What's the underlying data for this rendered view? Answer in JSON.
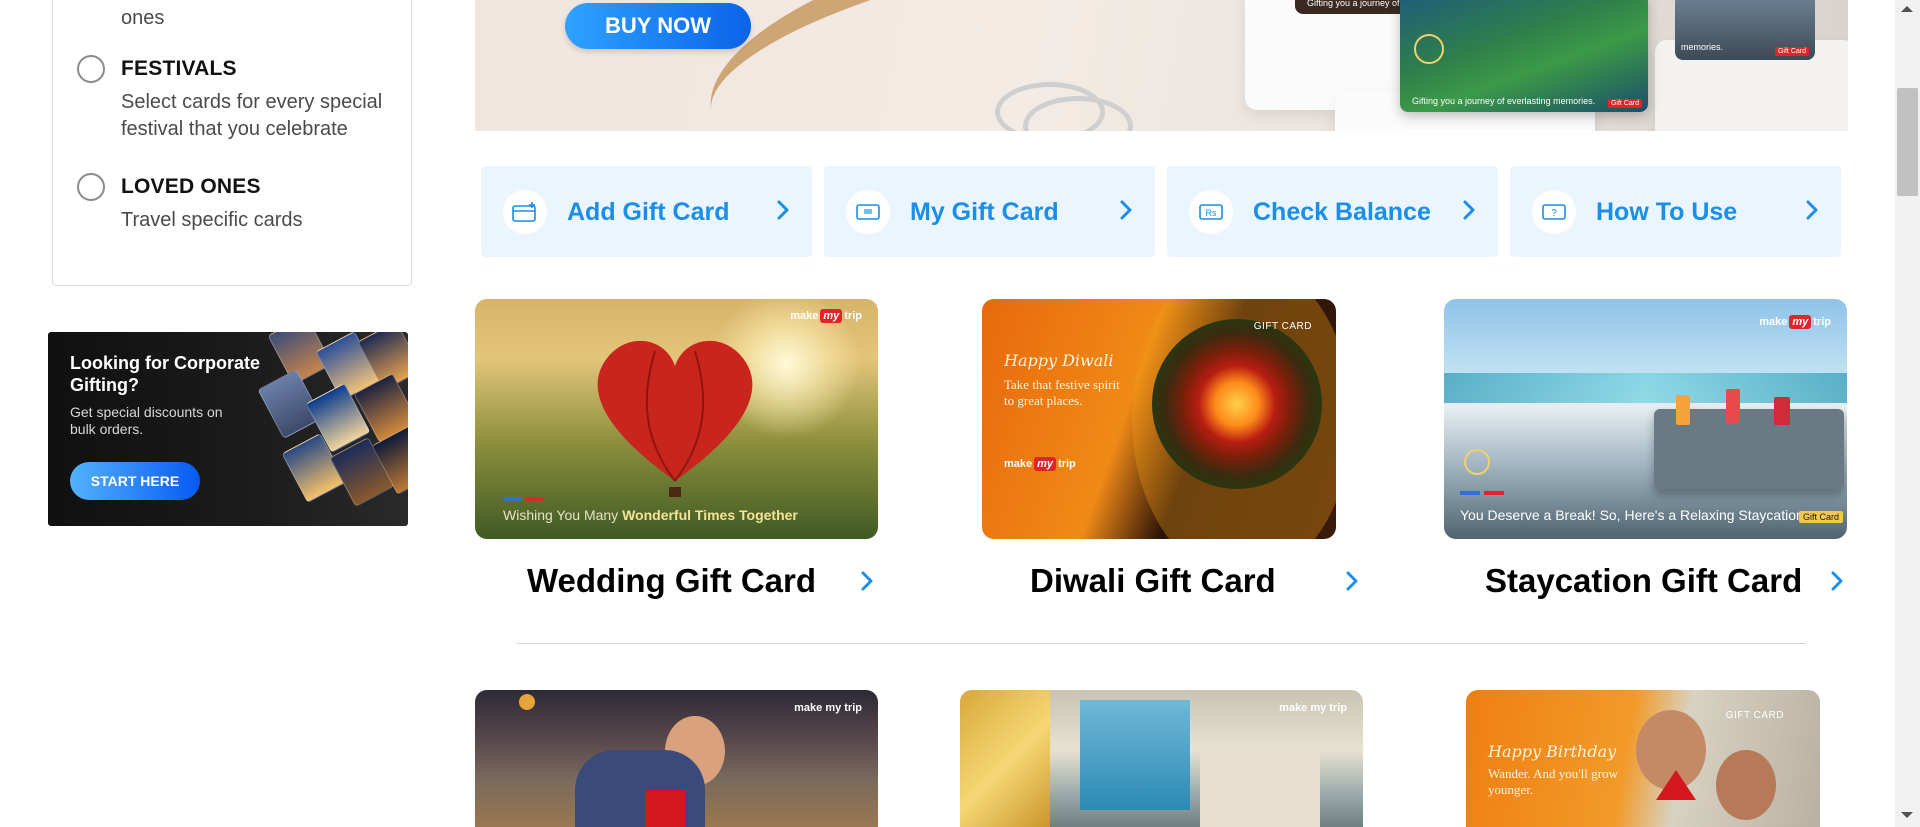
{
  "filters": [
    {
      "id": "loved-ones-top",
      "title": "",
      "desc": "ones"
    },
    {
      "id": "festivals",
      "title": "FESTIVALS",
      "desc": "Select cards for every special festival that you celebrate"
    },
    {
      "id": "loved-ones",
      "title": "LOVED ONES",
      "desc": "Travel specific cards"
    }
  ],
  "promo": {
    "title": "Looking for Corporate Gifting?",
    "subtitle": "Get special discounts on bulk orders.",
    "button": "START HERE"
  },
  "banner": {
    "button": "BUY NOW",
    "card_caption": "Gifting you a journey of everlasting memories.",
    "card_caption_partial": "Gifting you a journey of ev",
    "card_caption_right": "memories.",
    "card_badge": "Gift Card"
  },
  "tiles": [
    {
      "label": "Add Gift Card",
      "icon": "add-card-icon"
    },
    {
      "label": "My Gift Card",
      "icon": "my-card-icon"
    },
    {
      "label": "Check Balance",
      "icon": "rupee-card-icon"
    },
    {
      "label": "How To Use",
      "icon": "question-card-icon"
    }
  ],
  "gift_cards": [
    {
      "title": "Wedding Gift Card",
      "caption_plain": "Wishing You Many ",
      "caption_bold": "Wonderful Times Together",
      "brand": "make my trip"
    },
    {
      "title": "Diwali Gift Card",
      "script": "Happy Diwali",
      "tagline": "Take that festive spirit to great places.",
      "badge": "GIFT CARD",
      "brand": "make my trip"
    },
    {
      "title": "Staycation Gift Card",
      "caption": "You Deserve a Break! So, Here's a Relaxing Staycation.",
      "badge": "Gift Card",
      "brand": "make my trip"
    }
  ],
  "bottom_cards": [
    {
      "brand": "make my trip"
    },
    {
      "brand": "make my trip"
    },
    {
      "script": "Happy Birthday",
      "tagline": "Wander. And you'll grow younger.",
      "badge": "GIFT CARD"
    }
  ],
  "brand": {
    "make": "make",
    "my": "my",
    "trip": "trip"
  },
  "colors": {
    "accent": "#1a8ee8",
    "tile_bg": "#eaf5ff",
    "brand_red": "#e0242a",
    "button_blue": "#0a63e8"
  }
}
